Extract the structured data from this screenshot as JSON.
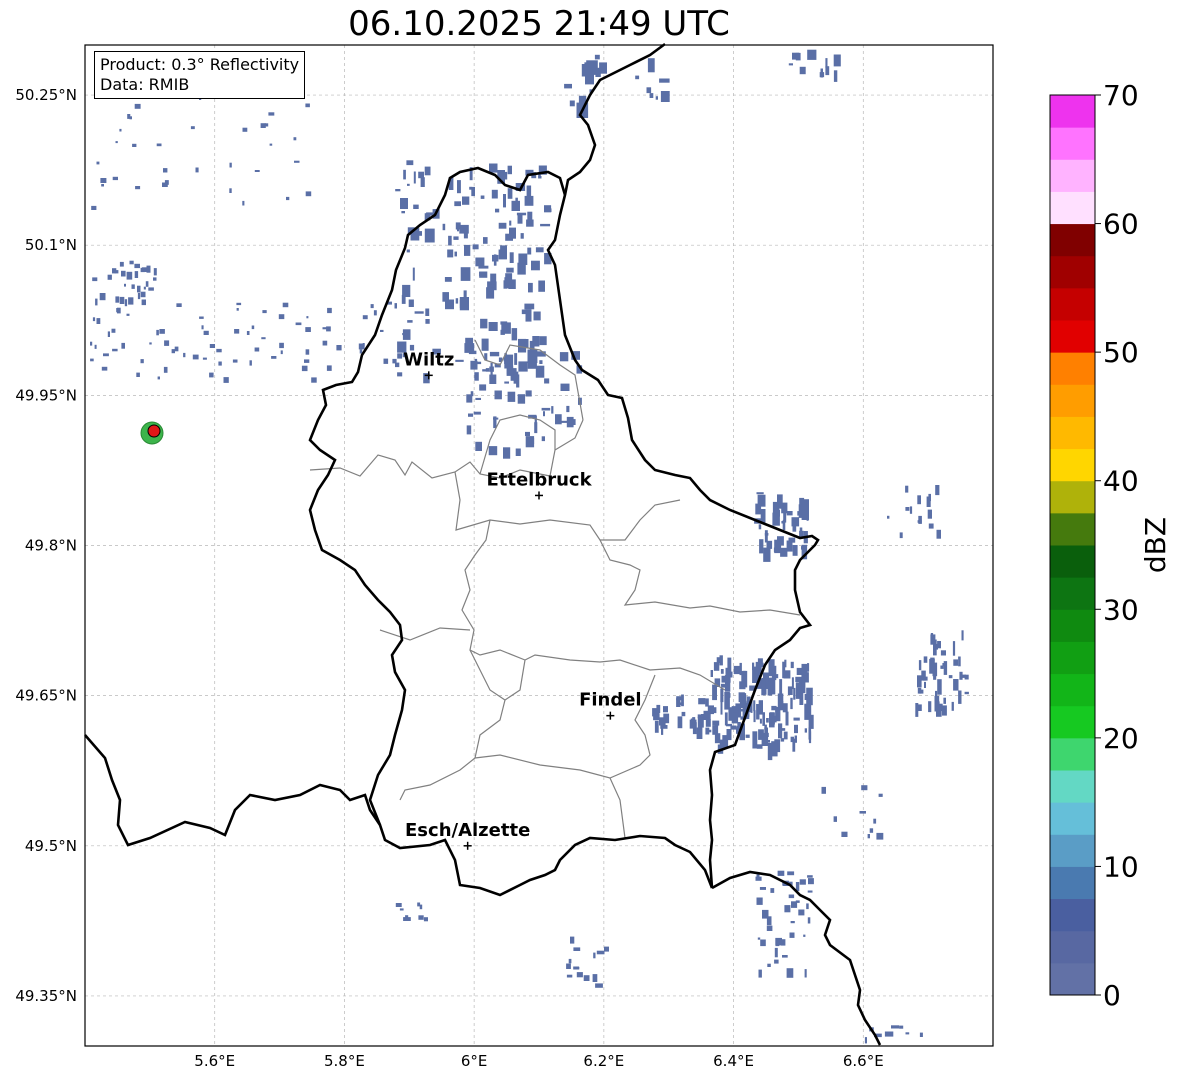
{
  "title": "06.10.2025 21:49 UTC",
  "info_box": {
    "product": "Product: 0.3° Reflectivity",
    "data_source": "Data: RMIB"
  },
  "map": {
    "lon_range": [
      5.4,
      6.8
    ],
    "lat_range": [
      49.3,
      50.3
    ],
    "lon_ticks": [
      "5.6°E",
      "5.8°E",
      "6°E",
      "6.2°E",
      "6.4°E",
      "6.6°E"
    ],
    "lat_ticks": [
      "50.25°N",
      "50.1°N",
      "49.95°N",
      "49.8°N",
      "49.65°N",
      "49.5°N",
      "49.35°N"
    ],
    "gridlines": true,
    "colors": {
      "border": "#000000",
      "admin": "#808080",
      "echo": "#5a6fa6",
      "radar_site": "#e01818"
    },
    "cities": [
      {
        "name": "Wiltz",
        "lon": 5.93,
        "lat": 49.97
      },
      {
        "name": "Ettelbruck",
        "lon": 6.1,
        "lat": 49.85
      },
      {
        "name": "Findel",
        "lon": 6.21,
        "lat": 49.63
      },
      {
        "name": "Esch/Alzette",
        "lon": 5.99,
        "lat": 49.5
      }
    ]
  },
  "colorbar": {
    "label": "dBZ",
    "ticks": [
      "0",
      "10",
      "20",
      "30",
      "40",
      "50",
      "60",
      "70"
    ],
    "colors": [
      "#6271a6",
      "#5868a2",
      "#4a5fa0",
      "#4a7ab0",
      "#5a9dc6",
      "#65bfd9",
      "#63d8c4",
      "#3ed66e",
      "#16c921",
      "#12b518",
      "#119f13",
      "#0f8a10",
      "#0d7512",
      "#0a5f0c",
      "#457a0d",
      "#afb20a",
      "#ffd600",
      "#ffb900",
      "#ff9d00",
      "#ff8000",
      "#e10000",
      "#c50000",
      "#a00000",
      "#800000",
      "#ffe0ff",
      "#ffb3ff",
      "#ff73ff",
      "#ee33ee"
    ]
  }
}
